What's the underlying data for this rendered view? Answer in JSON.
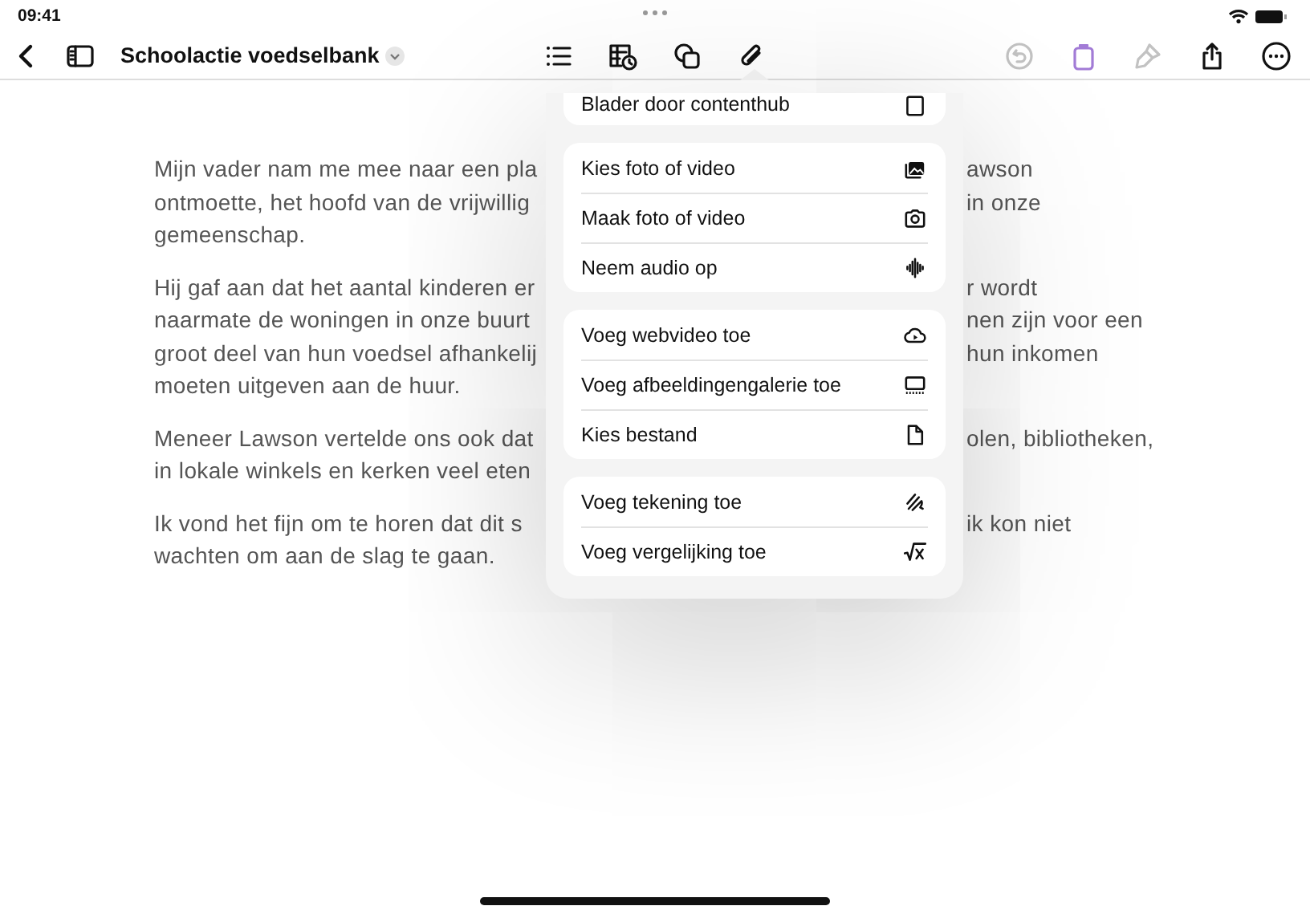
{
  "status_bar": {
    "time": "09:41"
  },
  "toolbar": {
    "title": "Schoolactie voedselbank",
    "left_tools": [
      {
        "kind": "back",
        "disabled": false
      },
      {
        "kind": "sidebar",
        "disabled": false
      }
    ],
    "center_tools": [
      {
        "kind": "list",
        "disabled": false
      },
      {
        "kind": "table",
        "disabled": false
      },
      {
        "kind": "shapes",
        "disabled": false
      },
      {
        "kind": "attach",
        "disabled": false
      }
    ],
    "right_tools": [
      {
        "kind": "undo",
        "disabled": true
      },
      {
        "kind": "jar",
        "disabled": false
      },
      {
        "kind": "brush",
        "disabled": true
      },
      {
        "kind": "share",
        "disabled": false
      },
      {
        "kind": "more",
        "disabled": false
      }
    ]
  },
  "document": {
    "paragraphs": [
      {
        "lines": [
          {
            "left": "Mijn vader nam me mee naar een pla",
            "right": "awson"
          },
          {
            "left": "ontmoette, het hoofd van de vrijwillig",
            "right": "in onze"
          },
          {
            "left": "gemeenschap."
          }
        ]
      },
      {
        "lines": [
          {
            "left": "Hij gaf aan dat het aantal kinderen er",
            "right": "r wordt"
          },
          {
            "left": "naarmate de woningen in onze buurt",
            "right": "nen zijn voor een"
          },
          {
            "left": "groot deel van hun voedsel afhankelij",
            "right": "hun inkomen"
          },
          {
            "left": "moeten uitgeven aan de huur."
          }
        ]
      },
      {
        "lines": [
          {
            "left": "Meneer Lawson vertelde ons ook dat",
            "right": "olen, bibliotheken,"
          },
          {
            "left": "in lokale winkels en kerken veel eten"
          }
        ]
      },
      {
        "lines": [
          {
            "left": "Ik vond het fijn om te horen dat dit s",
            "right": "ik kon niet"
          },
          {
            "left": "wachten om aan de slag te gaan."
          }
        ]
      }
    ]
  },
  "attach_menu": {
    "groups": [
      {
        "items": [
          {
            "label": "Blader door contenthub",
            "kind": "contenthub"
          }
        ]
      },
      {
        "items": [
          {
            "label": "Kies foto of video",
            "kind": "photos"
          },
          {
            "label": "Maak foto of video",
            "kind": "camera"
          },
          {
            "label": "Neem audio op",
            "kind": "audio"
          }
        ]
      },
      {
        "items": [
          {
            "label": "Voeg webvideo toe",
            "kind": "webvideo"
          },
          {
            "label": "Voeg afbeeldingengalerie toe",
            "kind": "gallery"
          },
          {
            "label": "Kies bestand",
            "kind": "file"
          }
        ]
      },
      {
        "items": [
          {
            "label": "Voeg tekening toe",
            "kind": "drawing"
          },
          {
            "label": "Voeg vergelijking toe",
            "kind": "equation"
          }
        ]
      }
    ]
  }
}
